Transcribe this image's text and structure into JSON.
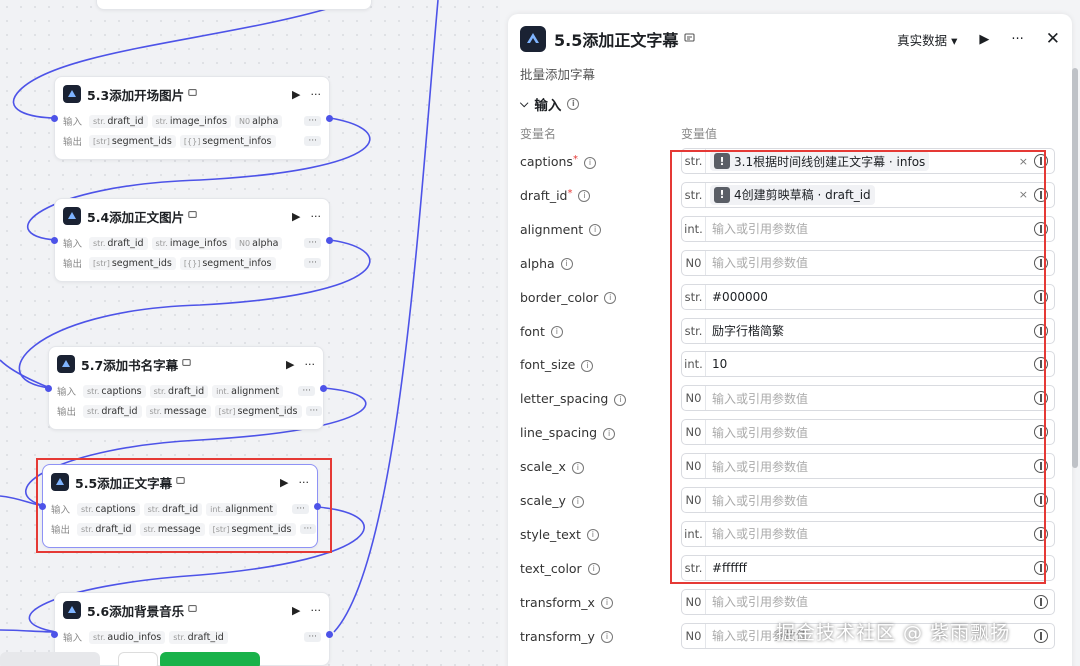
{
  "canvas": {
    "nodes": [
      {
        "id": "n53",
        "title": "5.3添加开场图片",
        "inputs": [
          {
            "t": "str.",
            "v": "draft_id"
          },
          {
            "t": "str.",
            "v": "image_infos"
          },
          {
            "t": "N0",
            "v": "alpha"
          }
        ],
        "outputs": [
          {
            "t": "[str]",
            "v": "segment_ids"
          },
          {
            "t": "[{}]",
            "v": "segment_infos"
          }
        ]
      },
      {
        "id": "n54",
        "title": "5.4添加正文图片",
        "inputs": [
          {
            "t": "str.",
            "v": "draft_id"
          },
          {
            "t": "str.",
            "v": "image_infos"
          },
          {
            "t": "N0",
            "v": "alpha"
          }
        ],
        "outputs": [
          {
            "t": "[str]",
            "v": "segment_ids"
          },
          {
            "t": "[{}]",
            "v": "segment_infos"
          }
        ]
      },
      {
        "id": "n57",
        "title": "5.7添加书名字幕",
        "inputs": [
          {
            "t": "str.",
            "v": "captions"
          },
          {
            "t": "str.",
            "v": "draft_id"
          },
          {
            "t": "int.",
            "v": "alignment"
          }
        ],
        "outputs": [
          {
            "t": "str.",
            "v": "draft_id"
          },
          {
            "t": "str.",
            "v": "message"
          },
          {
            "t": "[str]",
            "v": "segment_ids"
          }
        ]
      },
      {
        "id": "n55",
        "title": "5.5添加正文字幕",
        "inputs": [
          {
            "t": "str.",
            "v": "captions"
          },
          {
            "t": "str.",
            "v": "draft_id"
          },
          {
            "t": "int.",
            "v": "alignment"
          }
        ],
        "outputs": [
          {
            "t": "str.",
            "v": "draft_id"
          },
          {
            "t": "str.",
            "v": "message"
          },
          {
            "t": "[str]",
            "v": "segment_ids"
          }
        ]
      },
      {
        "id": "n56",
        "title": "5.6添加背景音乐",
        "inputs": [
          {
            "t": "str.",
            "v": "audio_infos"
          },
          {
            "t": "str.",
            "v": "draft_id"
          }
        ],
        "outputs": []
      }
    ],
    "row_in_label": "输入",
    "row_out_label": "输出",
    "more_label": "···",
    "colors": {
      "edge": "#4d53e8",
      "highlight": "#e53935",
      "primary": "#19b24a"
    }
  },
  "panel": {
    "title": "5.5添加正文字幕",
    "description": "批量添加字幕",
    "dataset_label": "真实数据",
    "section_label": "输入",
    "col_name": "变量名",
    "col_value": "变量值",
    "params": [
      {
        "name": "captions",
        "required": true,
        "type": "str.",
        "ref": "3.1根据时间线创建正文字幕 · infos"
      },
      {
        "name": "draft_id",
        "required": true,
        "type": "str.",
        "ref": "4创建剪映草稿 · draft_id"
      },
      {
        "name": "alignment",
        "type": "int.",
        "placeholder": "输入或引用参数值"
      },
      {
        "name": "alpha",
        "type": "N0",
        "placeholder": "输入或引用参数值"
      },
      {
        "name": "border_color",
        "type": "str.",
        "value": "#000000"
      },
      {
        "name": "font",
        "type": "str.",
        "value": "励字行楷简繁"
      },
      {
        "name": "font_size",
        "type": "int.",
        "value": "10"
      },
      {
        "name": "letter_spacing",
        "type": "N0",
        "placeholder": "输入或引用参数值"
      },
      {
        "name": "line_spacing",
        "type": "N0",
        "placeholder": "输入或引用参数值"
      },
      {
        "name": "scale_x",
        "type": "N0",
        "placeholder": "输入或引用参数值"
      },
      {
        "name": "scale_y",
        "type": "N0",
        "placeholder": "输入或引用参数值"
      },
      {
        "name": "style_text",
        "type": "int.",
        "placeholder": "输入或引用参数值"
      },
      {
        "name": "text_color",
        "type": "str.",
        "value": "#ffffff"
      },
      {
        "name": "transform_x",
        "type": "N0",
        "placeholder": "输入或引用参数值"
      },
      {
        "name": "transform_y",
        "type": "N0",
        "placeholder": "输入或引用参数值"
      }
    ]
  },
  "watermark": "掘金技术社区 @ 紫雨飘扬"
}
